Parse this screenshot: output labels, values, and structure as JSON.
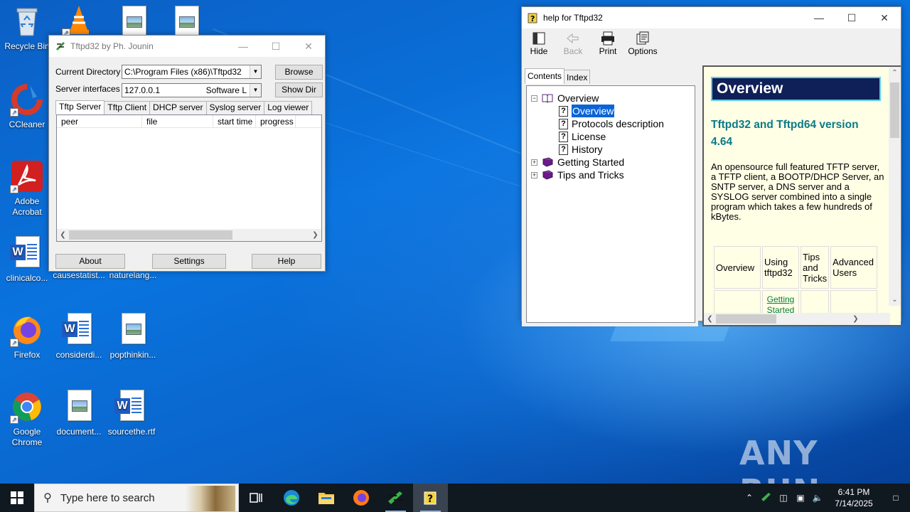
{
  "desktop": {
    "icons": [
      {
        "label": "Recycle Bin"
      },
      {
        "label": "CCleaner"
      },
      {
        "label": "Adobe Acrobat"
      },
      {
        "label": "clinicalco..."
      },
      {
        "label": "Firefox"
      },
      {
        "label": "Google Chrome"
      },
      {
        "label": "causestatist..."
      },
      {
        "label": "naturelang..."
      },
      {
        "label": "considerdi..."
      },
      {
        "label": "popthinkin..."
      },
      {
        "label": "document..."
      },
      {
        "label": "sourcethe.rtf"
      }
    ],
    "watermark": "ANY RUN"
  },
  "tftpd": {
    "title": "Tftpd32 by Ph. Jounin",
    "current_dir_label": "Current Directory",
    "current_dir_value": "C:\\Program Files (x86)\\Tftpd32",
    "server_if_label": "Server interfaces",
    "server_if_value": "127.0.0.1",
    "server_if_extra": "Software L",
    "browse": "Browse",
    "show_dir": "Show Dir",
    "tabs": [
      "Tftp Server",
      "Tftp Client",
      "DHCP server",
      "Syslog server",
      "Log viewer"
    ],
    "columns": [
      "peer",
      "file",
      "start time",
      "progress"
    ],
    "about": "About",
    "settings": "Settings",
    "help": "Help"
  },
  "help_window": {
    "title": "help for Tftpd32",
    "toolbar": [
      "Hide",
      "Back",
      "Print",
      "Options"
    ],
    "tabs": [
      "Contents",
      "Index"
    ],
    "tree": [
      {
        "label": "Overview"
      },
      {
        "label": "Overview"
      },
      {
        "label": "Protocols description"
      },
      {
        "label": "License"
      },
      {
        "label": "History"
      },
      {
        "label": "Getting Started"
      },
      {
        "label": "Tips and Tricks"
      }
    ],
    "content": {
      "banner": "Overview",
      "heading": "Tftpd32 and Tftpd64 version 4.64",
      "paragraph": "An opensource full featured TFTP server, a TFTP client, a BOOTP/DHCP Server, an SNTP server, a DNS server and a SYSLOG server combined into a single program which takes a few hundreds of kBytes.",
      "table_head": [
        "Overview",
        "Using tftpd32",
        "Tips and Tricks",
        "Advanced Users"
      ],
      "table_link": "Getting Started"
    }
  },
  "taskbar": {
    "search_placeholder": "Type here to search",
    "time": "6:41 PM",
    "date": "7/14/2025"
  }
}
